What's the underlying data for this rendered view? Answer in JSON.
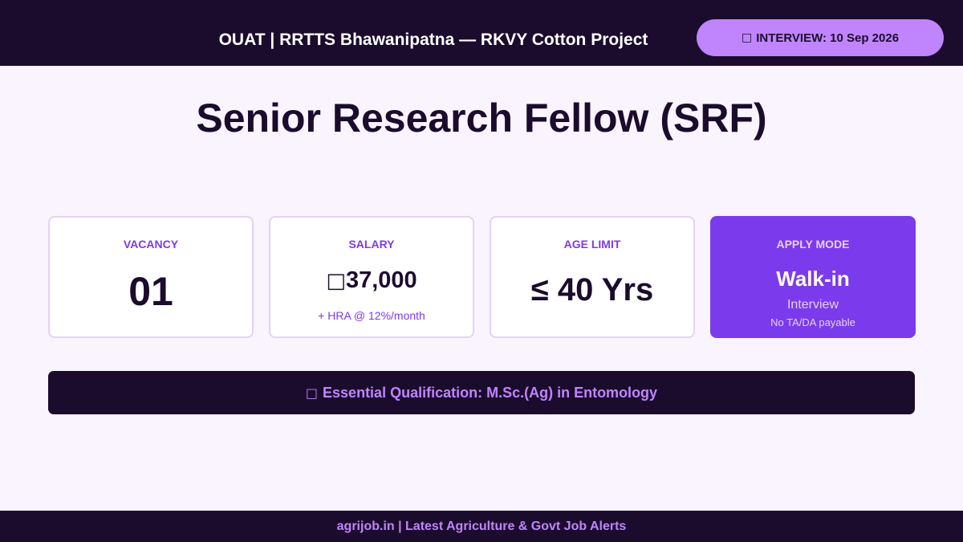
{
  "header": {
    "title": "OUAT | RRTTS Bhawanipatna — RKVY Cotton Project",
    "interview_icon": "calendar-icon",
    "interview_glyph": "□",
    "interview_label": "INTERVIEW: 10 Sep 2026"
  },
  "post_title": "Senior Research Fellow (SRF)",
  "cards": {
    "vacancy": {
      "label": "VACANCY",
      "value": "01"
    },
    "salary": {
      "label": "SALARY",
      "currency_glyph": "□",
      "value": "37,000",
      "note": "+ HRA @ 12%/month"
    },
    "age": {
      "label": "AGE LIMIT",
      "value": "≤ 40 Yrs"
    },
    "apply": {
      "label": "APPLY MODE",
      "value": "Walk-in",
      "sub": "Interview",
      "note": "No TA/DA payable"
    }
  },
  "qualification": {
    "icon": "graduation-cap-icon",
    "glyph": "□",
    "text": "Essential Qualification: M.Sc.(Ag) in Entomology"
  },
  "footer": {
    "text": "agrijob.in | Latest Agriculture & Govt Job Alerts"
  },
  "colors": {
    "dark": "#1b0c2e",
    "accent": "#7c3aed",
    "light_accent": "#c084fc",
    "background": "#f9f4fe"
  }
}
